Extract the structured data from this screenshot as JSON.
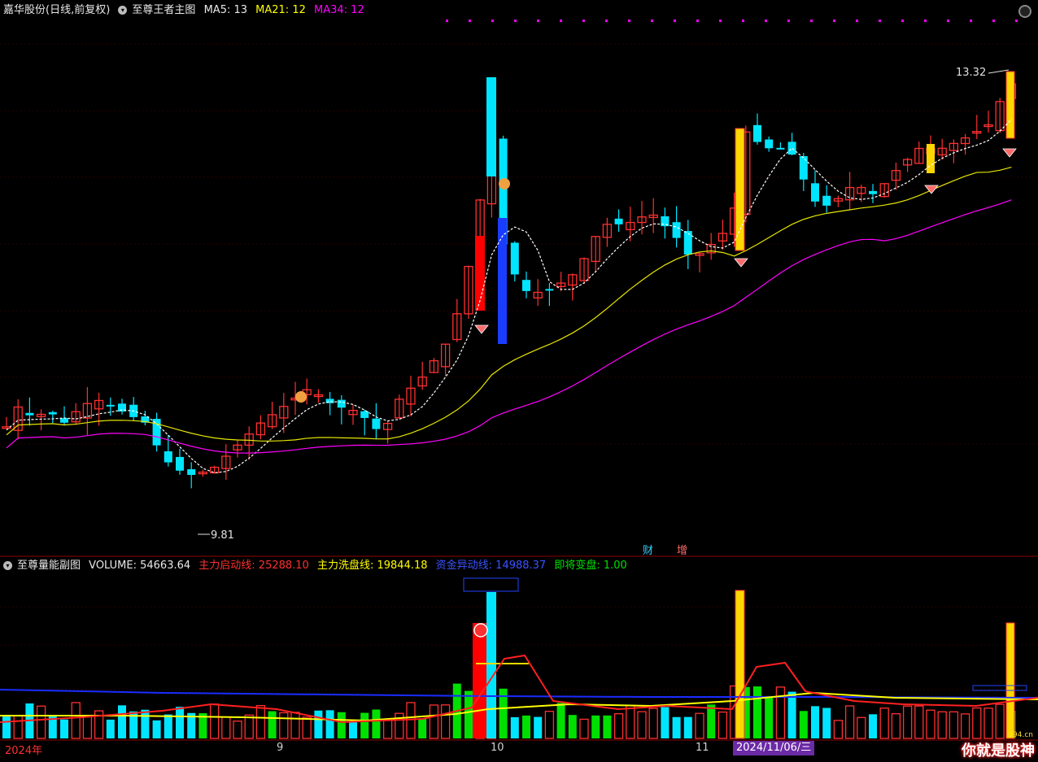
{
  "main": {
    "stock": "嘉华股份(日线,前复权)",
    "indicator": "至尊王者主图",
    "ma5": "MA5: 13",
    "ma21": "MA21: 12",
    "ma34": "MA34: 12",
    "high_label": "13.32",
    "low_label": "9.81",
    "tag_cai": "财",
    "tag_zeng": "增",
    "colors": {
      "up": "#ff3030",
      "down": "#00e5ff",
      "ma5": "#ffffff",
      "ma21": "#e6e600",
      "ma34": "#ff00ff",
      "highlight": "#ffd700",
      "blue_bar": "#1a3cff"
    }
  },
  "sub": {
    "indicator": "至尊量能副图",
    "volume": "VOLUME: 54663.64",
    "line1": "主力启动线: 25288.10",
    "line2": "主力洗盘线: 19844.18",
    "line3": "资金异动线: 14988.37",
    "line4": "即将变盘: 1.00"
  },
  "axis": {
    "year": "2024年",
    "m9": "9",
    "m10": "10",
    "m11": "11",
    "cursor_date": "2024/11/06/三"
  },
  "brand": {
    "text": "你就是股神",
    "sub": "894.cn"
  }
}
